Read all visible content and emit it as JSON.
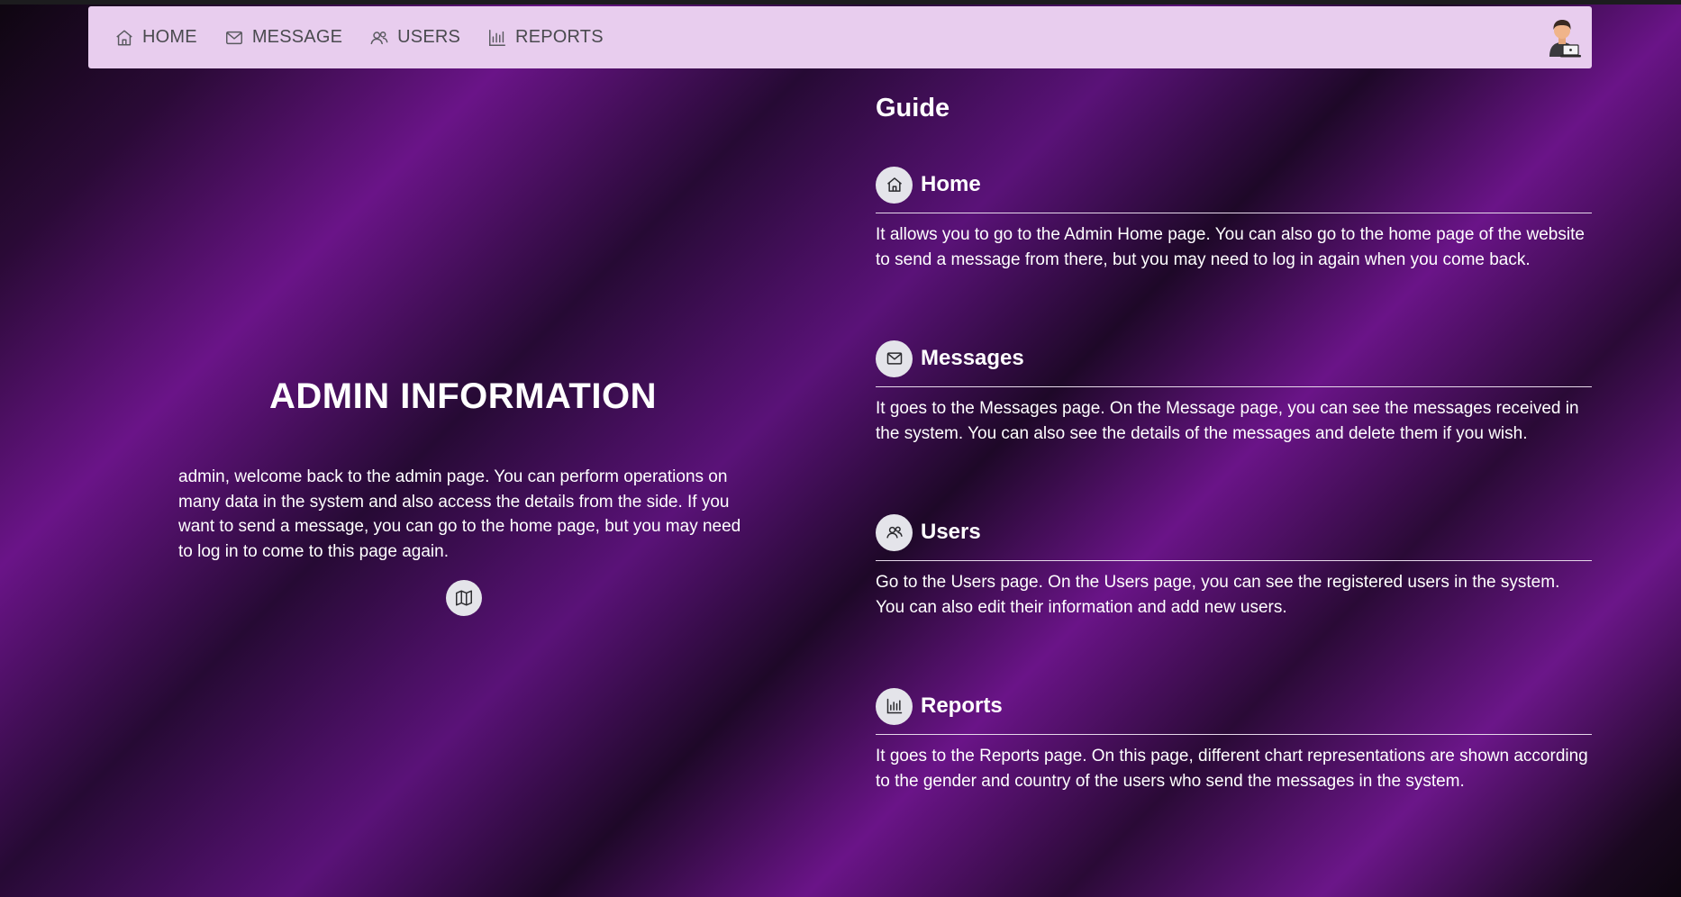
{
  "nav": {
    "items": [
      {
        "label": "HOME",
        "icon": "home-icon"
      },
      {
        "label": "MESSAGE",
        "icon": "envelope-icon"
      },
      {
        "label": "USERS",
        "icon": "users-icon"
      },
      {
        "label": "REPORTS",
        "icon": "bar-chart-icon"
      }
    ],
    "avatar_icon": "user-avatar-icon"
  },
  "admin": {
    "title": "ADMIN INFORMATION",
    "text": "admin, welcome back to the admin page. You can perform operations on many data in the system and also access the details from the side. If you want to send a message, you can go to the home page, but you may need to log in to come to this page again.",
    "map_icon": "map-icon"
  },
  "guide": {
    "title": "Guide",
    "sections": [
      {
        "label": "Home",
        "icon": "home-icon",
        "text": "It allows you to go to the Admin Home page. You can also go to the home page of the website to send a message from there, but you may need to log in again when you come back."
      },
      {
        "label": "Messages",
        "icon": "envelope-icon",
        "text": "It goes to the Messages page. On the Message page, you can see the messages received in the system. You can also see the details of the messages and delete them if you wish."
      },
      {
        "label": "Users",
        "icon": "users-icon",
        "text": "Go to the Users page. On the Users page, you can see the registered users in the system. You can also edit their information and add new users."
      },
      {
        "label": "Reports",
        "icon": "bar-chart-icon",
        "text": "It goes to the Reports page. On this page, different chart representations are shown according to the gender and country of the users who send the messages in the system."
      }
    ]
  },
  "colors": {
    "navbar_bg": "#e8cdee",
    "nav_text": "#4a4a4f",
    "accent_purple": "#6a1488",
    "icon_circle_bg": "#e4e4ea"
  }
}
